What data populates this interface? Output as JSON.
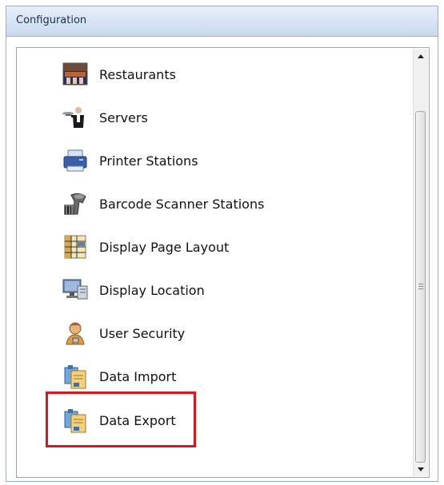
{
  "panel": {
    "title": "Configuration"
  },
  "items": [
    {
      "label": "Restaurants",
      "icon": "restaurant-icon"
    },
    {
      "label": "Servers",
      "icon": "server-waiter-icon"
    },
    {
      "label": "Printer Stations",
      "icon": "printer-icon"
    },
    {
      "label": "Barcode Scanner Stations",
      "icon": "barcode-scanner-icon"
    },
    {
      "label": "Display Page Layout",
      "icon": "page-layout-icon"
    },
    {
      "label": "Display Location",
      "icon": "monitor-icon"
    },
    {
      "label": "User Security",
      "icon": "user-security-icon"
    },
    {
      "label": "Data Import",
      "icon": "data-import-icon"
    },
    {
      "label": "Data Export",
      "icon": "data-export-icon"
    }
  ],
  "highlight_color": "#e0141c",
  "accent": "#8fb0d8"
}
